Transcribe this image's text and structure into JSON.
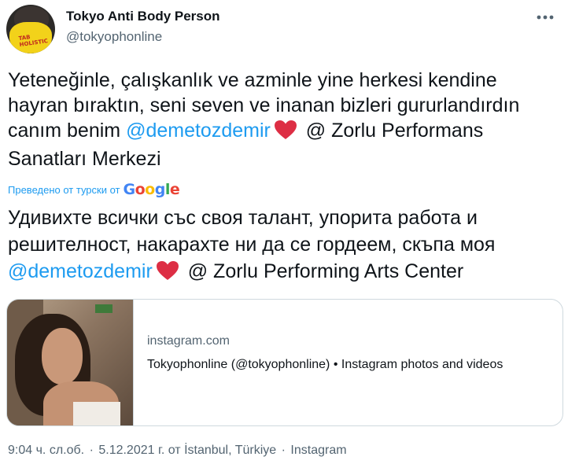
{
  "author": {
    "display_name": "Tokyo Anti Body Person",
    "handle": "@tokyophonline",
    "avatar_mask_text": "TAB HOLISTIC"
  },
  "tweet": {
    "text_part1": "Yeteneğinle, çalışkanlık ve azminle yine herkesi kendine hayran bıraktın, seni seven ve inanan bizleri gururlandırdın canım benim ",
    "mention": "@demetozdemir",
    "text_part2": " @ Zorlu Performans Sanatları Merkezi"
  },
  "translation": {
    "label": "Преведено от турски от",
    "provider": "Google",
    "text_part1": "Удивихте всички със своя талант, упорита работа и решителност, накарахте ни да се гордеем, скъпа моя ",
    "mention": "@demetozdemir",
    "text_part2": " @ Zorlu Performing Arts Center"
  },
  "card": {
    "domain": "instagram.com",
    "title": "Tokyophonline (@tokyophonline) • Instagram photos and videos"
  },
  "meta": {
    "time": "9:04 ч. сл.об.",
    "separator": "·",
    "date": "5.12.2021 г.",
    "location": "от İstanbul, Türkiye",
    "source": "Instagram"
  },
  "colors": {
    "accent": "#1d9bf0",
    "heart": "#f91880",
    "secondary_text": "#536471"
  },
  "icons": {
    "more": "more-horizontal-icon",
    "heart": "heart-emoji-icon"
  }
}
